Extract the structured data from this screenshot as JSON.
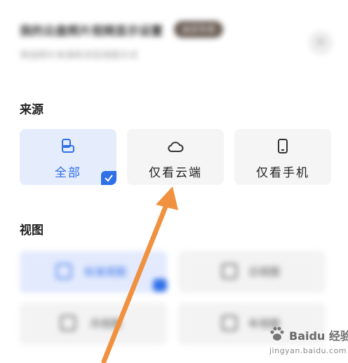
{
  "header": {
    "title": "我的云盘照片视频显示设置",
    "badge": "会员专享",
    "subtitle": "筛选照片来源和浏览视图方式",
    "close_icon": "close-icon"
  },
  "source_section": {
    "title": "来源",
    "options": [
      {
        "label": "全部",
        "icon": "photos-icon",
        "selected": true
      },
      {
        "label": "仅看云端",
        "icon": "cloud-icon",
        "selected": false
      },
      {
        "label": "仅看手机",
        "icon": "phone-icon",
        "selected": false
      }
    ]
  },
  "view_section": {
    "title": "视图",
    "options": [
      {
        "label": "标准视图",
        "selected": true
      },
      {
        "label": "日视图",
        "selected": false
      },
      {
        "label": "月视图",
        "selected": false
      },
      {
        "label": "年视图",
        "selected": false
      }
    ]
  },
  "watermark": {
    "brand": "Baidu 经验",
    "url": "jingyan.baidu.com"
  },
  "colors": {
    "accent": "#2f6fe8",
    "selected_bg": "#e5edfd",
    "card_bg": "#f5f5f5",
    "arrow": "#f0913f"
  }
}
